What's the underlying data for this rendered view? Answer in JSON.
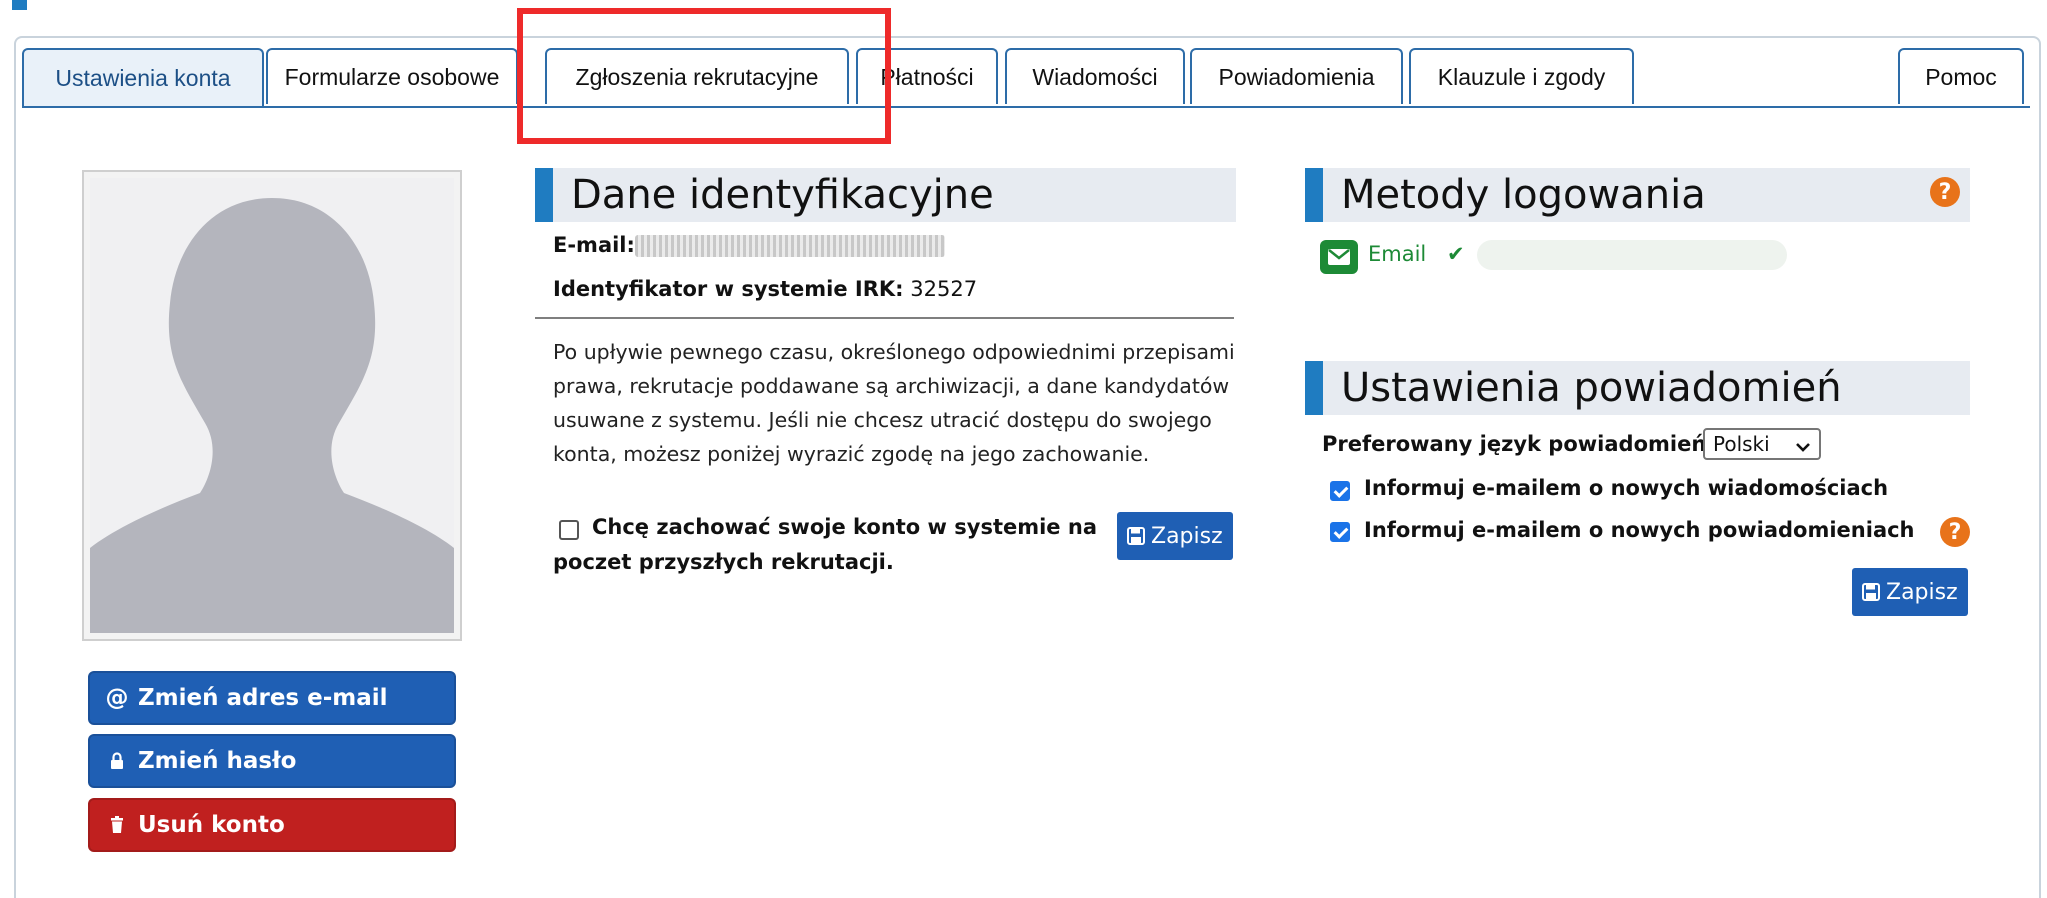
{
  "tabs": [
    {
      "label": "Ustawienia konta",
      "active": true
    },
    {
      "label": "Formularze osobowe"
    },
    {
      "label": "Zgłoszenia rekrutacyjne"
    },
    {
      "label": "Płatności"
    },
    {
      "label": "Wiadomości"
    },
    {
      "label": "Powiadomienia"
    },
    {
      "label": "Klauzule i zgody"
    }
  ],
  "help_tab": {
    "label": "Pomoc"
  },
  "sidebar": {
    "change_email": "Zmień adres e-mail",
    "change_password": "Zmień hasło",
    "delete_account": "Usuń konto"
  },
  "identity": {
    "heading": "Dane identyfikacyjne",
    "email_label": "E-mail:",
    "irk_label": "Identyfikator w systemie IRK:",
    "irk_value": "32527",
    "notice": "Po upływie pewnego czasu, określonego odpowiednimi przepisami prawa, rekrutacje poddawane są archiwizacji, a dane kandydatów usuwane z systemu. Jeśli nie chcesz utracić dostępu do swojego konta, możesz poniżej wyrazić zgodę na jego zachowanie.",
    "keep_account_line1": "Chcę zachować swoje konto w systemie na",
    "keep_account_line2": "poczet przyszłych rekrutacji.",
    "save": "Zapisz"
  },
  "login_methods": {
    "heading": "Metody logowania",
    "method": "Email"
  },
  "notifications": {
    "heading": "Ustawienia powiadomień",
    "lang_label": "Preferowany język powiadomień:",
    "lang_value": "Polski",
    "opt_messages": "Informuj e-mailem o nowych wiadomościach",
    "opt_notifications": "Informuj e-mailem o nowych powiadomieniach",
    "save": "Zapisz"
  },
  "colors": {
    "accent": "#1f7cc1",
    "button_blue": "#1f5fb4",
    "button_red": "#c0201f",
    "success_green": "#1d8a36",
    "help_orange": "#e8731a",
    "annotation_red": "#ee2a2a"
  }
}
